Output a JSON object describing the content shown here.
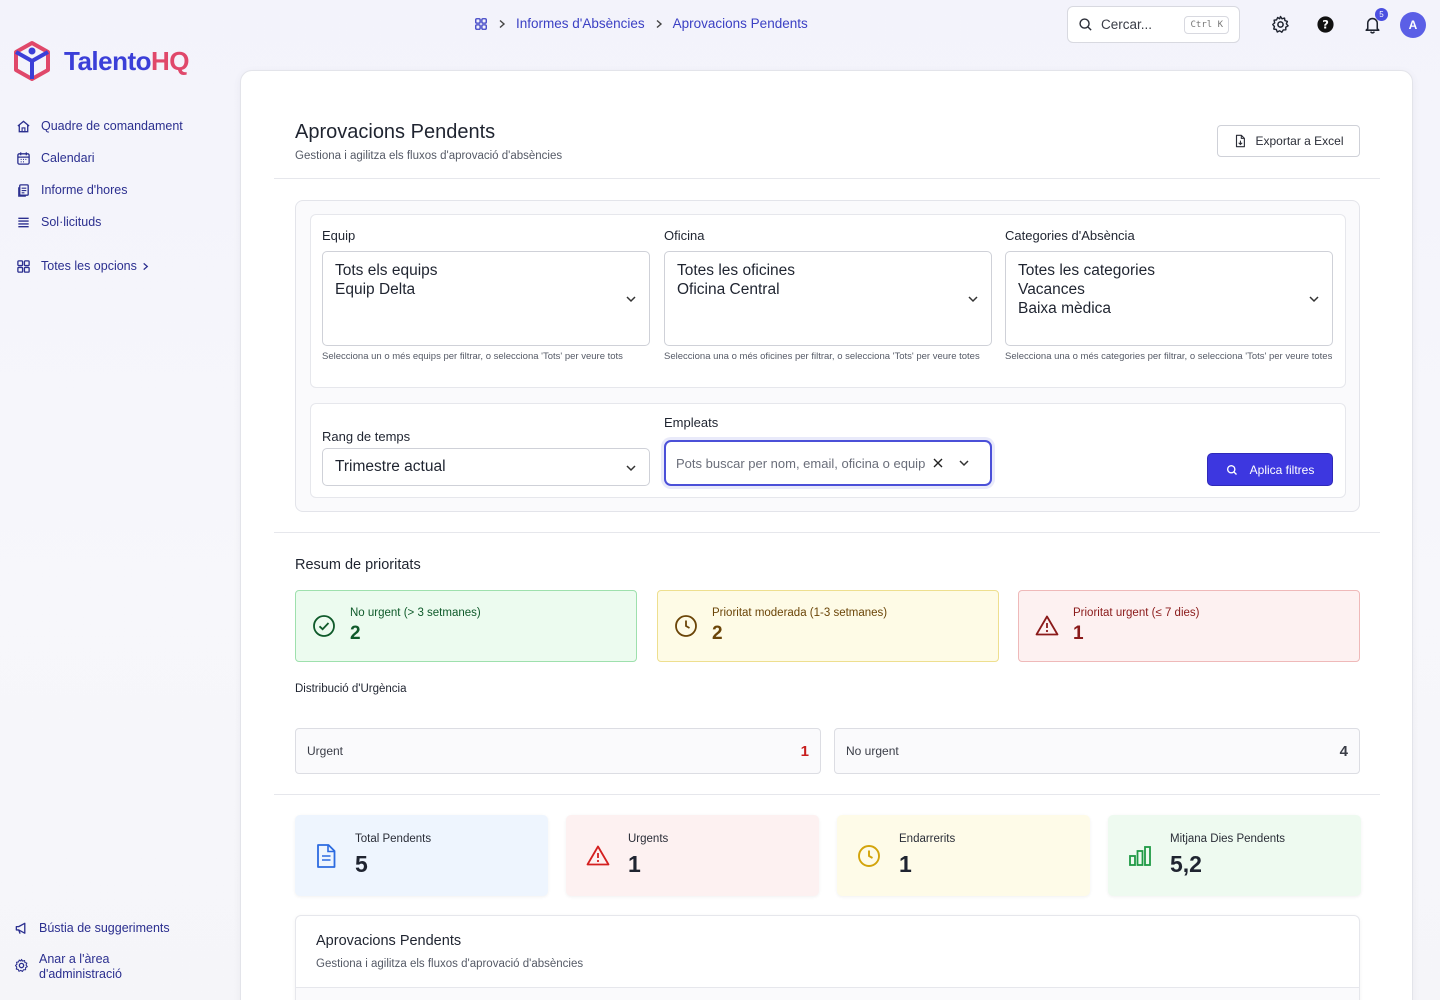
{
  "brand": {
    "name_main": "Talento",
    "name_accent": "HQ"
  },
  "sidebar": {
    "items": [
      {
        "label": "Quadre de comandament",
        "icon": "home-icon"
      },
      {
        "label": "Calendari",
        "icon": "calendar-icon"
      },
      {
        "label": "Informe d'hores",
        "icon": "report-icon"
      },
      {
        "label": "Sol·licituds",
        "icon": "list-icon"
      }
    ],
    "all_options": "Totes les opcions",
    "bottom": [
      {
        "label": "Bústia de suggeriments",
        "icon": "megaphone-icon"
      },
      {
        "label": "Anar a l'àrea d'administració",
        "icon": "gear-icon"
      }
    ]
  },
  "breadcrumb": {
    "section": "Informes d'Absències",
    "current": "Aprovacions Pendents"
  },
  "search": {
    "placeholder": "Cercar...",
    "shortcut": "Ctrl K"
  },
  "notifications": {
    "count": "5"
  },
  "user": {
    "initial": "A"
  },
  "page": {
    "title": "Aprovacions Pendents",
    "subtitle": "Gestiona i agilitza els fluxos d'aprovació d'absències",
    "export_label": "Exportar a Excel"
  },
  "filters": {
    "team": {
      "label": "Equip",
      "selected": [
        "Tots els equips",
        "Equip Delta"
      ],
      "help": "Selecciona un o més equips per filtrar, o selecciona 'Tots' per veure tots"
    },
    "office": {
      "label": "Oficina",
      "selected": [
        "Totes les oficines",
        "Oficina Central"
      ],
      "help": "Selecciona una o més oficines per filtrar, o selecciona 'Tots' per veure totes"
    },
    "category": {
      "label": "Categories d'Absència",
      "selected": [
        "Totes les categories",
        "Vacances",
        "Baixa mèdica"
      ],
      "help": "Selecciona una o més categories per filtrar, o selecciona 'Tots' per veure totes"
    },
    "time_range": {
      "label": "Rang de temps",
      "value": "Trimestre actual"
    },
    "employees": {
      "label": "Empleats",
      "placeholder": "Pots buscar per nom, email, oficina o equip"
    },
    "apply_label": "Aplica filtres"
  },
  "priority": {
    "title": "Resum de prioritats",
    "cards": [
      {
        "label": "No urgent (> 3 setmanes)",
        "value": "2"
      },
      {
        "label": "Prioritat moderada (1-3 setmanes)",
        "value": "2"
      },
      {
        "label": "Prioritat urgent (≤ 7 dies)",
        "value": "1"
      }
    ],
    "distribution_title": "Distribució d'Urgència",
    "distribution": [
      {
        "label": "Urgent",
        "value": "1"
      },
      {
        "label": "No urgent",
        "value": "4"
      }
    ]
  },
  "stats": [
    {
      "label": "Total Pendents",
      "value": "5"
    },
    {
      "label": "Urgents",
      "value": "1"
    },
    {
      "label": "Endarrerits",
      "value": "1"
    },
    {
      "label": "Mitjana Dies Pendents",
      "value": "5,2"
    }
  ],
  "table": {
    "title": "Aprovacions Pendents",
    "subtitle": "Gestiona i agilitza els fluxos d'aprovació d'absències"
  },
  "colors": {
    "accent": "#3d37e0",
    "brand_red": "#e0486a",
    "green": "#0f5a2a",
    "yellow": "#6b4508",
    "red": "#8a1a1a"
  }
}
